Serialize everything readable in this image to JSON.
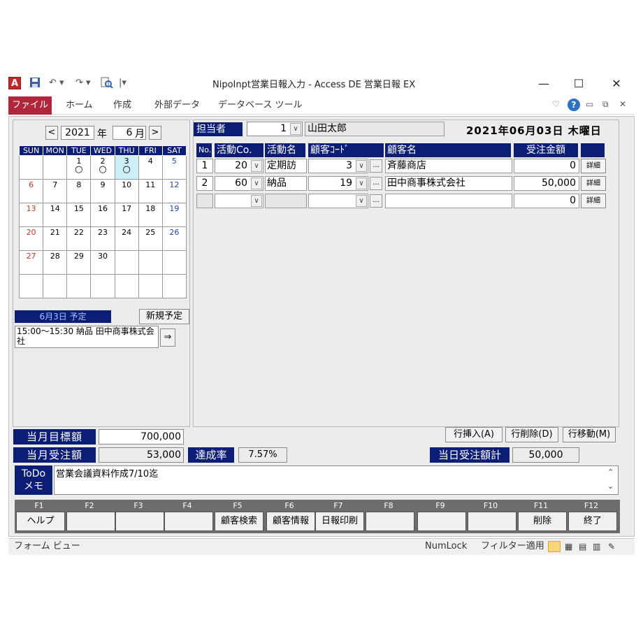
{
  "window": {
    "title": "NipoInpt営業日報入力 - Access DE 営業日報 EX",
    "minimize": "—",
    "maximize": "☐",
    "close": "✕"
  },
  "ribbon": {
    "file": "ファイル",
    "tabs": [
      "ホーム",
      "作成",
      "外部データ",
      "データベース ツール"
    ]
  },
  "calendar": {
    "prev": "<",
    "next": ">",
    "year": "2021",
    "year_suffix": "年",
    "month": "6",
    "month_suffix": "月",
    "weekdays": [
      "SUN",
      "MON",
      "TUE",
      "WED",
      "THU",
      "FRI",
      "SAT"
    ],
    "weeks": [
      [
        "",
        "",
        "1",
        "2",
        "3",
        "4",
        "5"
      ],
      [
        "6",
        "7",
        "8",
        "9",
        "10",
        "11",
        "12"
      ],
      [
        "13",
        "14",
        "15",
        "16",
        "17",
        "18",
        "19"
      ],
      [
        "20",
        "21",
        "22",
        "23",
        "24",
        "25",
        "26"
      ],
      [
        "27",
        "28",
        "29",
        "30",
        "",
        "",
        ""
      ],
      [
        "",
        "",
        "",
        "",
        "",
        "",
        ""
      ]
    ],
    "marked_days": [
      "1",
      "2",
      "3"
    ],
    "mark_symbol": "○",
    "today": "3"
  },
  "schedule": {
    "header": "6月3日 予定",
    "new_button": "新規予定",
    "item_text": "15:00～15:30 納品 田中商事株式会社",
    "arrow_button": "⇒"
  },
  "staff": {
    "label": "担当者",
    "code": "1",
    "name": "山田太郎",
    "date": "2021年06月03日 木曜日"
  },
  "table": {
    "headers": [
      "No.",
      "活動Co.",
      "活動名",
      "顧客ｺｰﾄﾞ",
      "顧客名",
      "受注金額"
    ],
    "detail_label": "詳細",
    "rows": [
      {
        "no": "1",
        "act_code": "20",
        "act_name": "定期訪",
        "cust_code": "3",
        "cust_name": "斉藤商店",
        "amount": "0"
      },
      {
        "no": "2",
        "act_code": "60",
        "act_name": "納品",
        "cust_code": "19",
        "cust_name": "田中商事株式会社",
        "amount": "50,000"
      },
      {
        "no": "",
        "act_code": "",
        "act_name": "",
        "cust_code": "",
        "cust_name": "",
        "amount": "0"
      }
    ],
    "dropdown_glyph": "∨",
    "dots_glyph": "..."
  },
  "row_buttons": {
    "insert": "行挿入(A)",
    "delete": "行削除(D)",
    "move": "行移動(M)"
  },
  "summary": {
    "target_label": "当月目標額",
    "target_value": "700,000",
    "orders_label": "当月受注額",
    "orders_value": "53,000",
    "rate_label": "達成率",
    "rate_value": "7.57%",
    "daily_label": "当日受注額計",
    "daily_value": "50,000"
  },
  "memo": {
    "label_line1": "ToDo",
    "label_line2": "メモ",
    "text": "営業会議資料作成7/10迄"
  },
  "fkeys": {
    "labels": [
      "F1",
      "F2",
      "F3",
      "F4",
      "F5",
      "F6",
      "F7",
      "F8",
      "F9",
      "F10",
      "F11",
      "F12"
    ],
    "buttons": [
      "ヘルプ",
      "",
      "",
      "",
      "顧客検索",
      "顧客情報",
      "日報印刷",
      "",
      "",
      "",
      "削除",
      "終了"
    ]
  },
  "status": {
    "view": "フォーム ビュー",
    "numlock": "NumLock",
    "filter": "フィルター適用"
  }
}
